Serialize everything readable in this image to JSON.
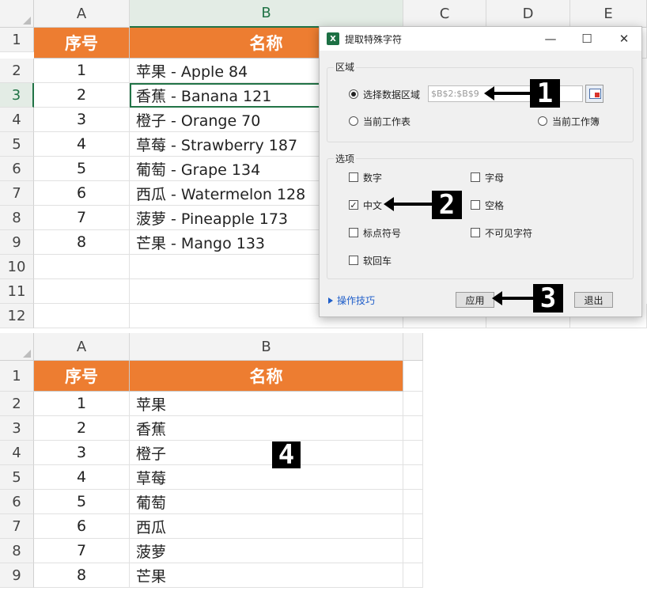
{
  "top_sheet": {
    "columns": [
      "A",
      "B",
      "C",
      "D",
      "E"
    ],
    "rows": [
      "1",
      "2",
      "3",
      "4",
      "5",
      "6",
      "7",
      "8",
      "9",
      "10",
      "11",
      "12"
    ],
    "header": {
      "a": "序号",
      "b": "名称"
    },
    "data": [
      {
        "n": "1",
        "name": "苹果 - Apple  84"
      },
      {
        "n": "2",
        "name": "香蕉 - Banana  121"
      },
      {
        "n": "3",
        "name": "橙子 - Orange  70"
      },
      {
        "n": "4",
        "name": "草莓 - Strawberry  187"
      },
      {
        "n": "5",
        "name": "葡萄 - Grape  134"
      },
      {
        "n": "6",
        "name": "西瓜 - Watermelon  128"
      },
      {
        "n": "7",
        "name": "菠萝 - Pineapple  173"
      },
      {
        "n": "8",
        "name": "芒果 - Mango  133"
      }
    ]
  },
  "dialog": {
    "title": "提取特殊字符",
    "minimize": "—",
    "maximize": "☐",
    "close": "✕",
    "region_group": "区域",
    "opt_selected_range": "选择数据区域",
    "range_value": "$B$2:$B$9",
    "opt_current_sheet": "当前工作表",
    "opt_current_book": "当前工作簿",
    "options_group": "选项",
    "chk_digits": "数字",
    "chk_letters": "字母",
    "chk_chinese": "中文",
    "chk_spaces": "空格",
    "chk_punct": "标点符号",
    "chk_invisible": "不可见字符",
    "chk_softreturn": "软回车",
    "tips": "操作技巧",
    "apply": "应用",
    "exit": "退出",
    "checkmark": "✓"
  },
  "bottom_sheet": {
    "columns": [
      "A",
      "B"
    ],
    "rows": [
      "1",
      "2",
      "3",
      "4",
      "5",
      "6",
      "7",
      "8",
      "9"
    ],
    "header": {
      "a": "序号",
      "b": "名称"
    },
    "data": [
      {
        "n": "1",
        "name": "苹果"
      },
      {
        "n": "2",
        "name": "香蕉"
      },
      {
        "n": "3",
        "name": "橙子"
      },
      {
        "n": "4",
        "name": "草莓"
      },
      {
        "n": "5",
        "name": "葡萄"
      },
      {
        "n": "6",
        "name": "西瓜"
      },
      {
        "n": "7",
        "name": "菠萝"
      },
      {
        "n": "8",
        "name": "芒果"
      }
    ]
  },
  "markers": [
    "1",
    "2",
    "3",
    "4"
  ]
}
